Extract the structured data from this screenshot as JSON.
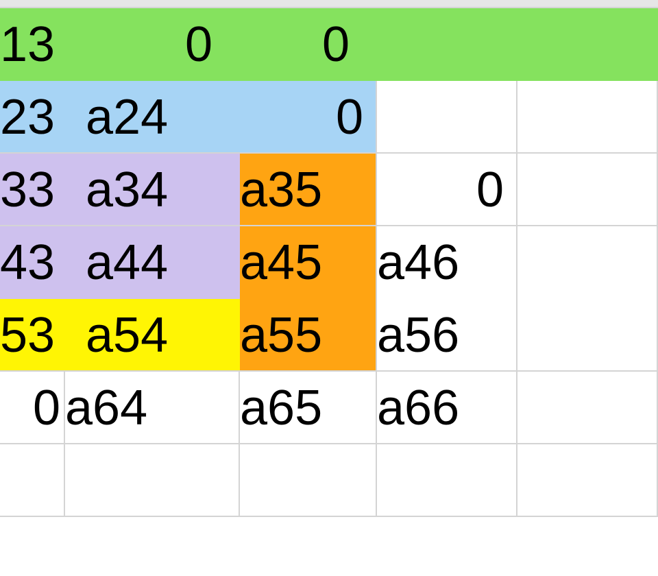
{
  "colors": {
    "green": "#85e25e",
    "blue": "#a7d4f5",
    "lilac": "#cec1ee",
    "orange": "#ffa412",
    "yellow": "#fff504",
    "white": "#ffffff"
  },
  "grid": {
    "r1": {
      "c0": "13",
      "c1": "0",
      "c2": "0",
      "c3": "",
      "c4": ""
    },
    "r2": {
      "c0": "23",
      "c1": "a24",
      "c2": "0",
      "c3": "",
      "c4": ""
    },
    "r3": {
      "c0": "33",
      "c1": "a34",
      "c2": "a35",
      "c3": "0",
      "c4": ""
    },
    "r4": {
      "c0": "43",
      "c1": "a44",
      "c2": "a45",
      "c3": "a46",
      "c4": ""
    },
    "r5": {
      "c0": "53",
      "c1": "a54",
      "c2": "a55",
      "c3": "a56",
      "c4": ""
    },
    "r6": {
      "c0": "0",
      "c1": "a64",
      "c2": "a65",
      "c3": "a66",
      "c4": ""
    },
    "r7": {
      "c0": "",
      "c1": "",
      "c2": "",
      "c3": "",
      "c4": ""
    }
  }
}
